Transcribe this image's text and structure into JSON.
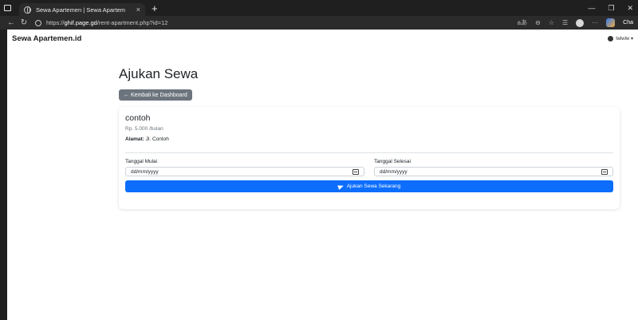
{
  "browser": {
    "tab_title": "Sewa Apartemen | Sewa Apartem",
    "tab_close": "×",
    "new_tab": "+",
    "url_prefix": "https://",
    "url_domain": "ghif.page.gd",
    "url_path": "/rent-apartment.php?id=12",
    "copilot_label": "Cha"
  },
  "navbar": {
    "brand": "Sewa Apartemen.id",
    "user": "lwlwlw ▾"
  },
  "main": {
    "title": "Ajukan Sewa",
    "back_label": "← Kembali ke Dashboard",
    "apartment": {
      "name": "contoh",
      "price": "Rp. 5.000 /bulan",
      "address_label": "Alamat:",
      "address_value": " Jl. Contoh"
    },
    "form": {
      "start_label": "Tanggal Mulai",
      "start_value": "dd/mm/yyyy",
      "end_label": "Tanggal Selesai",
      "end_value": "dd/mm/yyyy",
      "submit_label": "Ajukan Sewa Sekarang"
    }
  },
  "colors": {
    "primary": "#0d6efd",
    "secondary": "#6c757d"
  }
}
